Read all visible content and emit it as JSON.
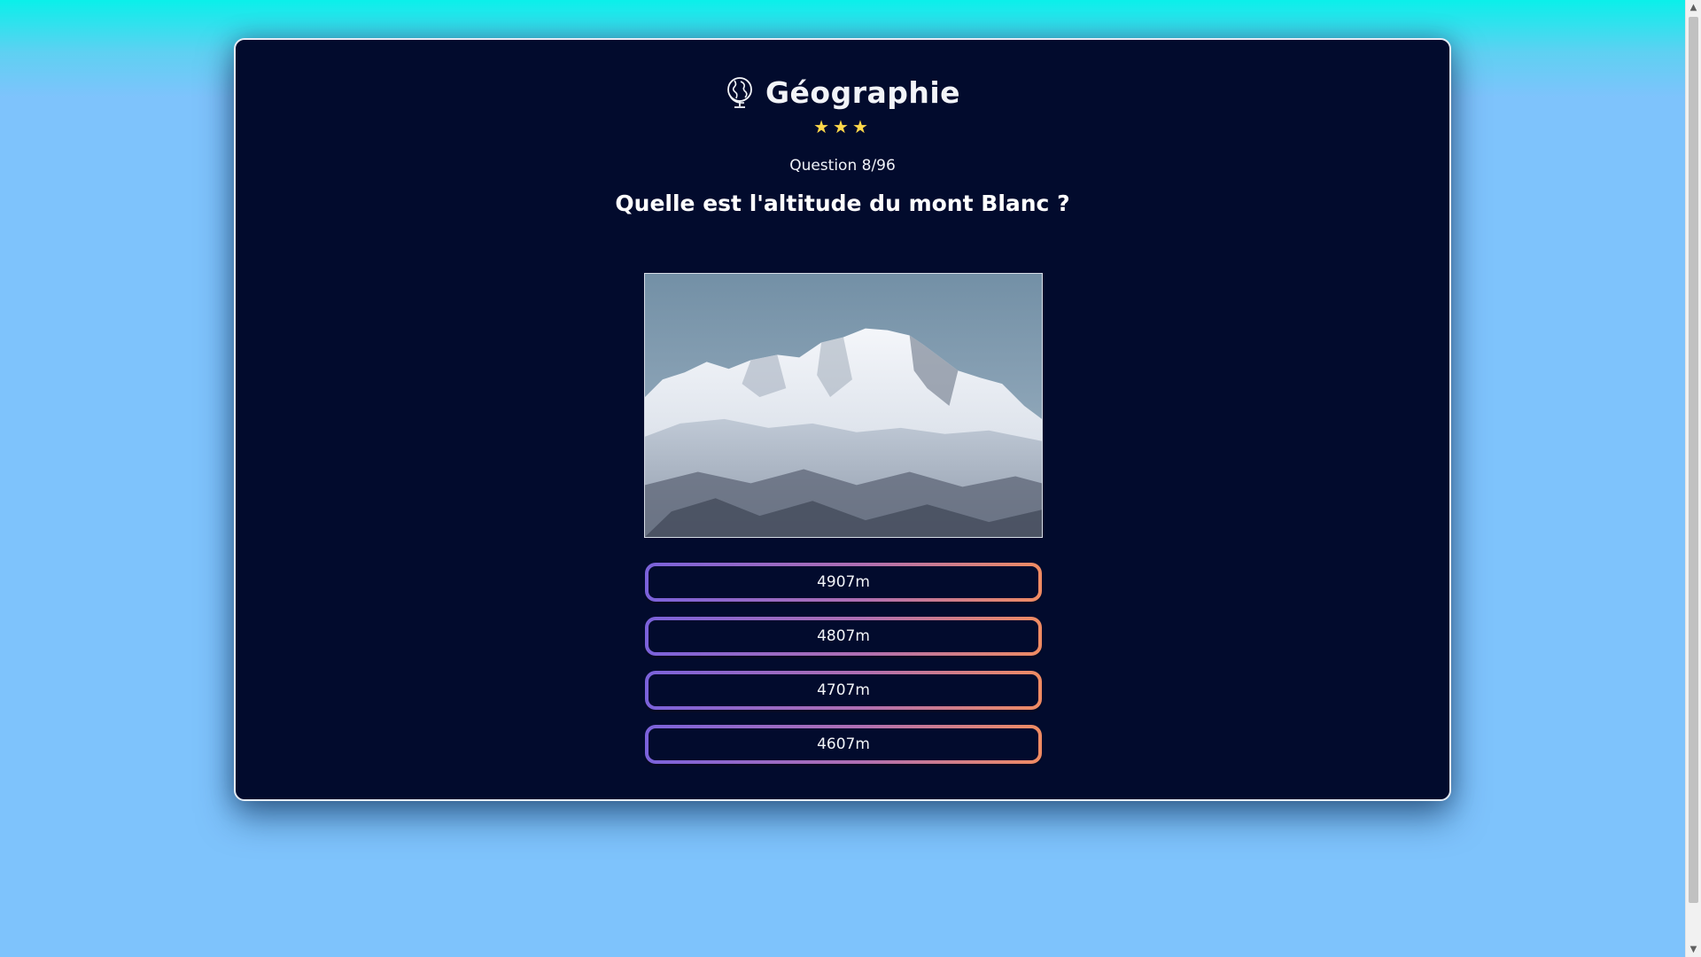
{
  "quiz": {
    "category": "Géographie",
    "category_icon": "globe-icon",
    "stars": "★★★",
    "counter": "Question 8/96",
    "question": "Quelle est l'altitude du mont Blanc ?",
    "image_subject": "mont-blanc-photo",
    "answers": [
      {
        "label": "4907m"
      },
      {
        "label": "4807m"
      },
      {
        "label": "4707m"
      },
      {
        "label": "4607m"
      }
    ]
  },
  "colors": {
    "card_background": "#020b2d",
    "page_background": "#7ec3fc",
    "star": "#ffd84a",
    "answer_gradient_start": "#7b62db",
    "answer_gradient_end": "#f08b62"
  }
}
